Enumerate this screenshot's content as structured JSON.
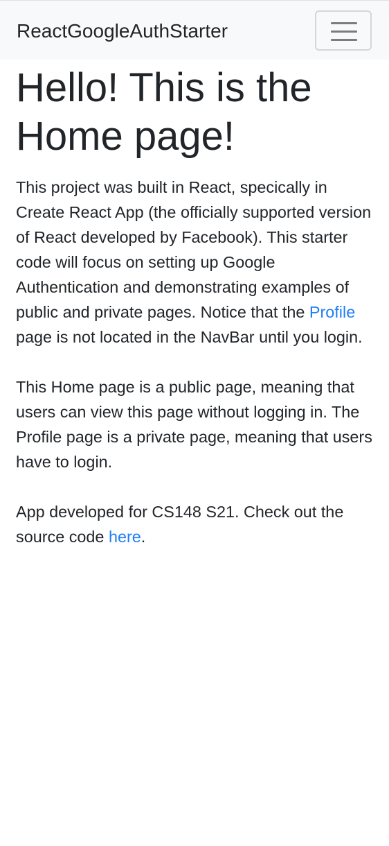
{
  "navbar": {
    "brand": "ReactGoogleAuthStarter",
    "toggler_icon": "hamburger-menu-icon"
  },
  "main": {
    "heading": "Hello! This is the Home page!",
    "p1": {
      "text_before": "This project was built in React, specically in Create React App (the officially supported version of React developed by Facebook). This starter code will focus on setting up Google Authentication and demonstrating examples of public and private pages. Notice that the ",
      "link": "Profile",
      "text_after": " page is not located in the NavBar until you login."
    },
    "p2": "This Home page is a public page, meaning that users can view this page without logging in. The Profile page is a private page, meaning that users have to login.",
    "p3": {
      "text_before": "App developed for CS148 S21. Check out the source code ",
      "link": "here",
      "text_after": "."
    }
  },
  "colors": {
    "link": "#1f7ef5",
    "navbar_bg": "#f8f9fa",
    "text": "#212529"
  }
}
